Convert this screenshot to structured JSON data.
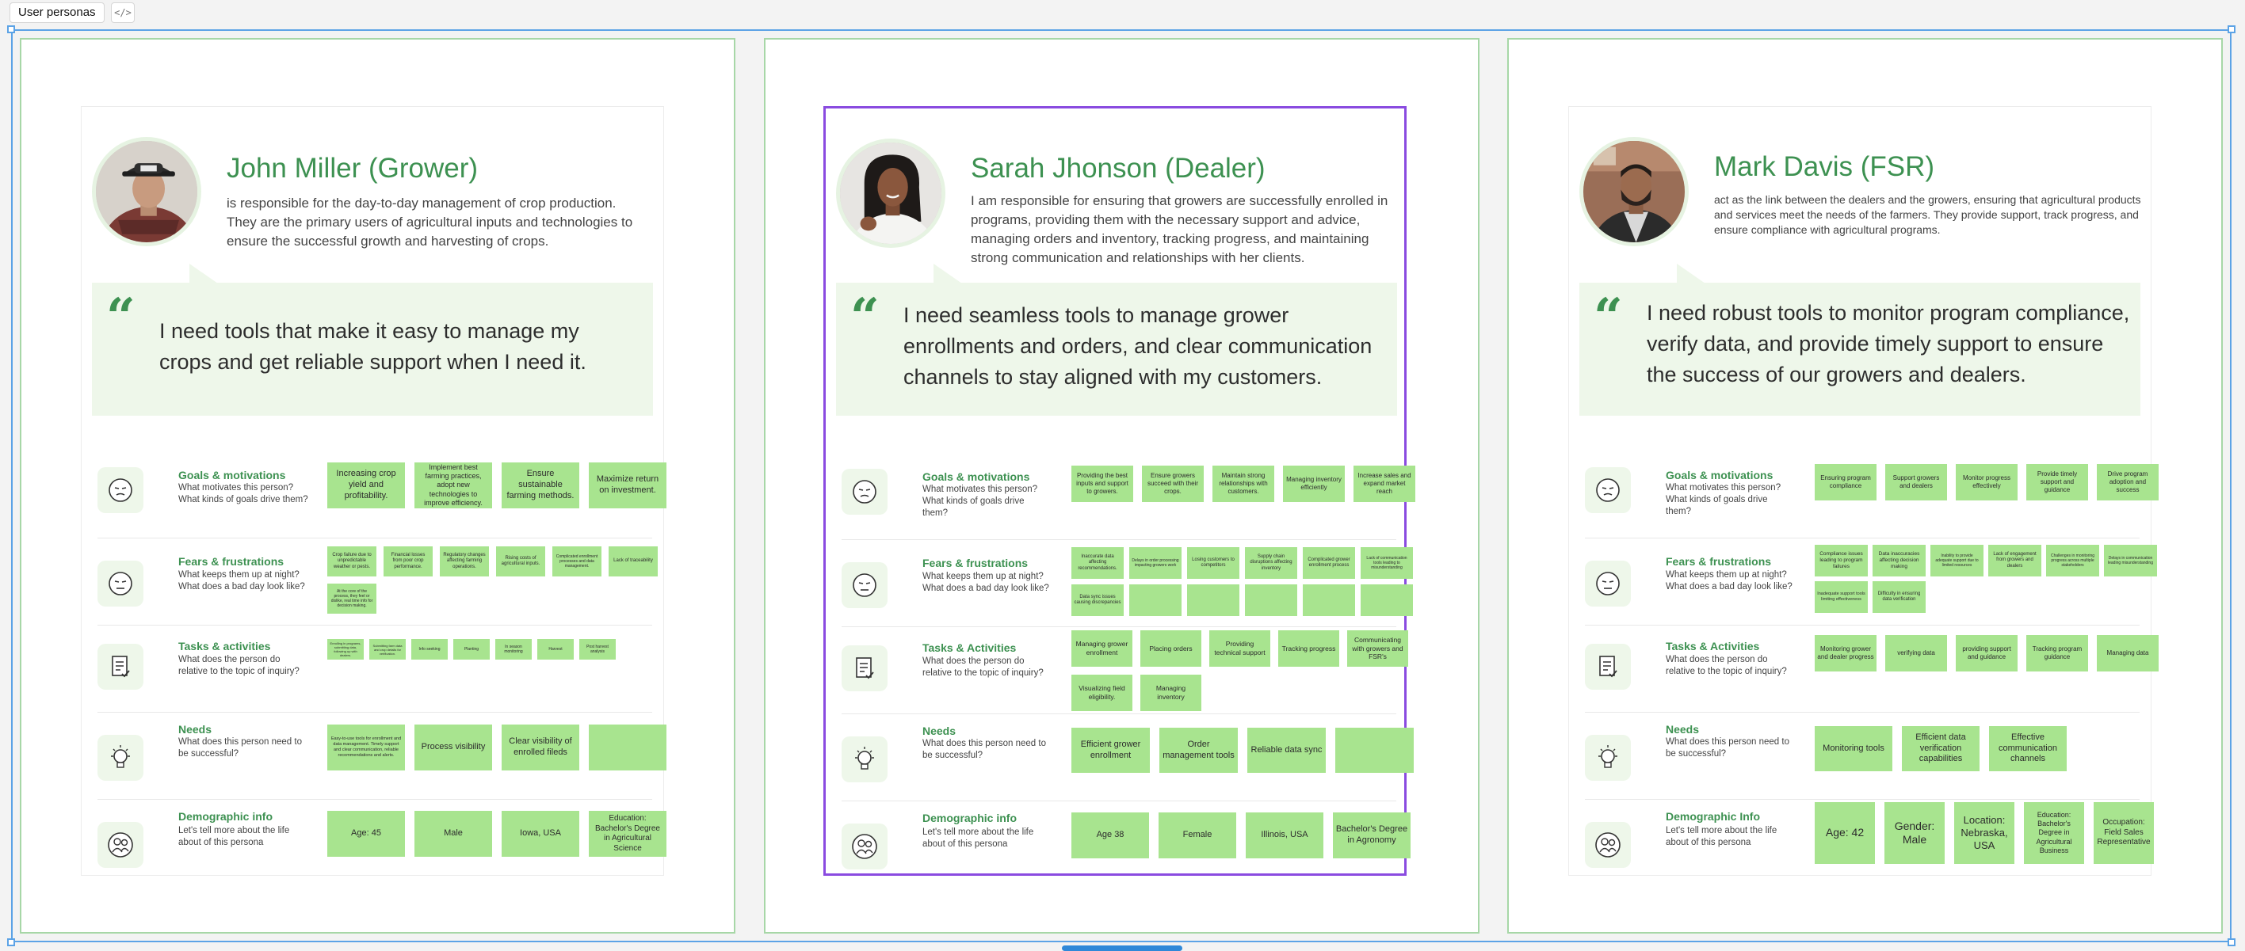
{
  "frame": {
    "label": "User personas",
    "code_icon": "code-icon"
  },
  "colors": {
    "accent_green": "#3d9151",
    "sticky_green": "#a8e48f",
    "quote_bg": "#eef7ea",
    "selection_blue": "#5ca3e6",
    "selected_purple": "#8a4be0"
  },
  "sections": {
    "goals": {
      "title": "Goals & motivations",
      "sub": "What motivates this person? What kinds of goals drive them?",
      "icon": "face-icon"
    },
    "fears": {
      "title": "Fears & frustrations",
      "sub": "What keeps them up at night? What does a bad day look like?",
      "icon": "frustrated-face-icon"
    },
    "tasks": {
      "title": "Tasks & activities",
      "title_alt": "Tasks & Activities",
      "sub": "What does the person do relative to the topic of inquiry?",
      "icon": "checklist-icon"
    },
    "needs": {
      "title": "Needs",
      "sub": "What does this person need to be successful?",
      "icon": "lightbulb-icon"
    },
    "demo": {
      "title": "Demographic info",
      "title_alt": "Demographic Info",
      "sub": "Let's tell more about the life about of this persona",
      "icon": "people-icon"
    }
  },
  "personas": [
    {
      "name": "John Miller (Grower)",
      "description": "is responsible for the day-to-day management of crop production. They are the primary users of agricultural inputs and technologies to ensure the successful growth and harvesting of crops.",
      "quote": "I need tools that make it easy to manage my crops and get reliable support when I need it.",
      "goals": [
        "Increasing crop yield and profitability.",
        "Implement best farming practices, adopt new technologies to improve efficiency.",
        "Ensure sustainable farming methods.",
        "Maximize return on investment."
      ],
      "fears": [
        "Crop failure due to unpredictable weather or pests.",
        "Financial losses from poor crop performance.",
        "Regulatory changes affecting farming operations.",
        "Rising costs of agricultural inputs.",
        "Complicated enrollment processes and data management.",
        "Lack of traceability",
        "At the core of the process, they feel or dislike, real time info for decision making."
      ],
      "tasks": [
        "Enrolling in programs, submitting data, following up with dealers.",
        "Submitting farm data and crop details for verification.",
        "Info seeking",
        "Planting",
        "In season monitoring",
        "Harvest",
        "Post harvest analysis"
      ],
      "needs": [
        "Easy-to-use tools for enrollment and data management. Timely support and clear communication, reliable recommendations and alerts.",
        "Process visibility",
        "Clear visibility of enrolled fileds",
        ""
      ],
      "demo": [
        "Age: 45",
        "Male",
        "Iowa, USA",
        "Education: Bachelor's Degree in Agricultural Science"
      ]
    },
    {
      "name": "Sarah Jhonson (Dealer)",
      "description": "I am responsible for ensuring that growers are successfully enrolled in programs, providing them with the necessary support and advice, managing orders and inventory, tracking progress, and maintaining strong communication and relationships with her clients.",
      "quote": "I need seamless tools to manage grower enrollments and orders, and clear communication channels to stay aligned with my customers.",
      "goals": [
        "Providing the best inputs and support to growers.",
        "Ensure growers succeed with their crops.",
        "Maintain strong relationships with customers.",
        "Managing inventory efficiently",
        "Increase sales and expand market reach"
      ],
      "fears": [
        "Inaccurate data affecting recommendations.",
        "Delays in order processing impacting growers work",
        "Losing customers to competitors",
        "Supply chain disruptions affecting inventory",
        "Complicated grower enrollment process",
        "Lack of communication tools leading to misunderstanding",
        "Data sync issues causing discrepancies",
        "",
        "",
        "",
        "",
        ""
      ],
      "tasks": [
        "Managing grower enrollment",
        "Placing orders",
        "Providing technical support",
        "Tracking progress",
        "Communicating with growers and FSR's",
        "Visualizing field eligibility.",
        "Managing inventory"
      ],
      "needs": [
        "Efficient grower enrollment",
        "Order management tools",
        "Reliable data sync",
        ""
      ],
      "demo": [
        "Age 38",
        "Female",
        "Illinois, USA",
        "Bachelor's Degree in Agronomy"
      ]
    },
    {
      "name": "Mark Davis (FSR)",
      "description": "act as the link between the dealers and the growers, ensuring that agricultural products and services meet the needs of the farmers. They provide support, track progress, and ensure compliance with agricultural programs.",
      "quote": "I need robust tools to monitor program compliance, verify data, and provide timely support to ensure the success of our growers and dealers.",
      "goals": [
        "Ensuring program compliance",
        "Support growers and dealers",
        "Monitor progress effectively",
        "Provide timely support and guidance",
        "Drive program adoption and success"
      ],
      "fears": [
        "Compliance issues leading to program failures",
        "Data inaccuracies affecting decision making",
        "Inability to provide adequate support due to limited resources",
        "Lack of engagement from growers and dealers",
        "Challenges in monitoring progress across multiple stakeholders",
        "Delays in communication leading misunderstanding",
        "Inadequate support tools limiting effectiveness",
        "Difficulty in ensuring data verification"
      ],
      "tasks": [
        "Monitoring grower and dealer progress",
        "verifying data",
        "providing support and guidance",
        "Tracking program guidance",
        "Managing data"
      ],
      "needs": [
        "Monitoring tools",
        "Efficient data verification capabilities",
        "Effective communication channels"
      ],
      "demo": [
        "Age: 42",
        "Gender: Male",
        "Location: Nebraska, USA",
        "Education: Bachelor's Degree in Agricultural Business",
        "Occupation: Field Sales Representative"
      ]
    }
  ]
}
